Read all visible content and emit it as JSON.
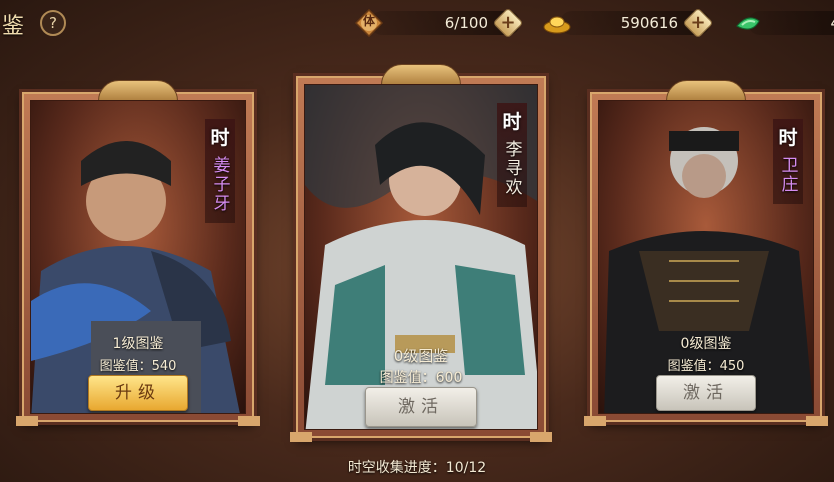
{
  "header": {
    "title": "鉴",
    "help_icon": "question-mark-icon",
    "stamina": {
      "icon": "stamina-badge-icon",
      "glyph": "体",
      "value": "6/100"
    },
    "gold": {
      "icon": "gold-ingot-icon",
      "value": "590616"
    },
    "jade": {
      "icon": "jade-icon",
      "value": "4"
    }
  },
  "cards": [
    {
      "era_glyph": "时",
      "name": "姜子牙",
      "name_color": "#d58cf0",
      "level": "1级图鉴",
      "value": "图鉴值：540",
      "button": "升级",
      "button_style": "gold"
    },
    {
      "era_glyph": "时",
      "name": "李寻欢",
      "name_color": "#f2ece0",
      "level": "0级图鉴",
      "value": "图鉴值：600",
      "button": "激活",
      "button_style": "grey"
    },
    {
      "era_glyph": "时",
      "name": "卫庄",
      "name_color": "#d58cf0",
      "level": "0级图鉴",
      "value": "图鉴值：450",
      "button": "激活",
      "button_style": "grey"
    }
  ],
  "footer": {
    "progress_text": "时空收集进度：10/12"
  }
}
